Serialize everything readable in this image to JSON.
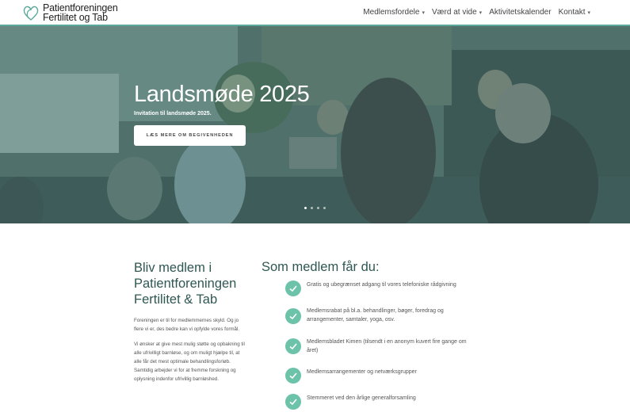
{
  "header": {
    "logo_line1": "Patientforeningen",
    "logo_line2": "Fertilitet og Tab",
    "nav": [
      {
        "label": "Medlemsfordele",
        "has_dropdown": true
      },
      {
        "label": "Værd at vide",
        "has_dropdown": true
      },
      {
        "label": "Aktivitetskalender",
        "has_dropdown": false
      },
      {
        "label": "Kontakt",
        "has_dropdown": true
      }
    ]
  },
  "hero": {
    "title": "Landsmøde 2025",
    "subtitle": "Invitation til landsmøde 2025.",
    "button": "LÆS MERE OM BEGIVENHEDEN",
    "slide_count": 4,
    "active_slide": 1
  },
  "left": {
    "title": "Bliv medlem i Patientforeningen Fertilitet & Tab",
    "p1": "Foreningen er til for medlemmernes skyld. Og jo flere vi er, des bedre kan vi opfylde vores formål.",
    "p2": "Vi ønsker at give mest mulig støtte og opbakning til alle ufrivilligt barnløse, og om muligt hjælpe til, at alle får det mest optimale behandlingsforløb. Samtidig arbejder vi for at fremme forskning og oplysning indenfor ufrivillig barnløshed."
  },
  "right": {
    "title": "Som medlem får du:",
    "benefits": [
      "Gratis og ubegrænset adgang til vores telefoniske rådgivning",
      "Medlemsrabat på bl.a. behandlinger, bøger, foredrag og arrangementer, samtaler, yoga, osv.",
      "Medlemsbladet Kimen (tilsendt i en anonym kuvert fire gange om året)",
      "Medlemsarrangementer og netværksgrupper",
      "Stemmeret ved den årlige generalforsamling"
    ]
  },
  "colors": {
    "accent": "#5aa99a",
    "check": "#6cc3aa",
    "heading": "#2f5753"
  }
}
